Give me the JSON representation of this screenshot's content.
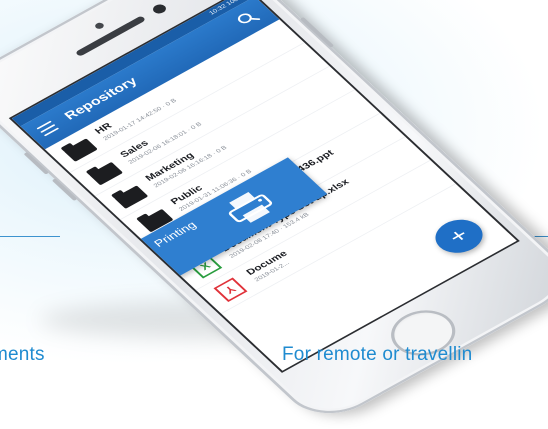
{
  "captions": {
    "left": "ments",
    "right": "For remote or travellin"
  },
  "status_bar": {
    "carrier": "",
    "time": "10:32 100%"
  },
  "app_bar": {
    "title": "Repository",
    "menu_icon": "hamburger-menu-icon",
    "search_icon": "search-icon"
  },
  "items": [
    {
      "type": "folder",
      "icon": "folder-icon",
      "name": "HR",
      "meta": "2019-01-17 14:42:50 · 0 B"
    },
    {
      "type": "folder",
      "icon": "folder-icon",
      "name": "Sales",
      "meta": "2019-02-06 16:18:01 · 0 B"
    },
    {
      "type": "folder",
      "icon": "folder-icon",
      "name": "Marketing",
      "meta": "2019-02-06 16:16:18 · 0 B"
    },
    {
      "type": "folder",
      "icon": "folder-icon",
      "name": "Public",
      "meta": "2019-01-31 11:06:36 · 0 B"
    },
    {
      "type": "file",
      "icon": "powerpoint-file-icon",
      "glyph": "P",
      "color": "#e07a1f",
      "name": "Presentation 1...43 13.436.ppt",
      "meta": "2019-02-06 16:20:45 · 735.9 kB"
    },
    {
      "type": "file",
      "icon": "excel-file-icon",
      "glyph": "X",
      "color": "#2a9d3f",
      "name": "Document Type Set up.xlsx",
      "meta": "2019-02-08 17:40 · 153.4 kB"
    },
    {
      "type": "file",
      "icon": "pdf-file-icon",
      "glyph": "⅄",
      "color": "#e0323a",
      "name": "Docume",
      "meta": "2019-01-2..."
    }
  ],
  "printing": {
    "label": "Printing",
    "icon": "printer-icon"
  },
  "fab": {
    "label": "+",
    "icon": "add-icon"
  },
  "colors": {
    "accent": "#2169b8",
    "caption": "#1f8bd0",
    "rule": "#3d93cf"
  }
}
